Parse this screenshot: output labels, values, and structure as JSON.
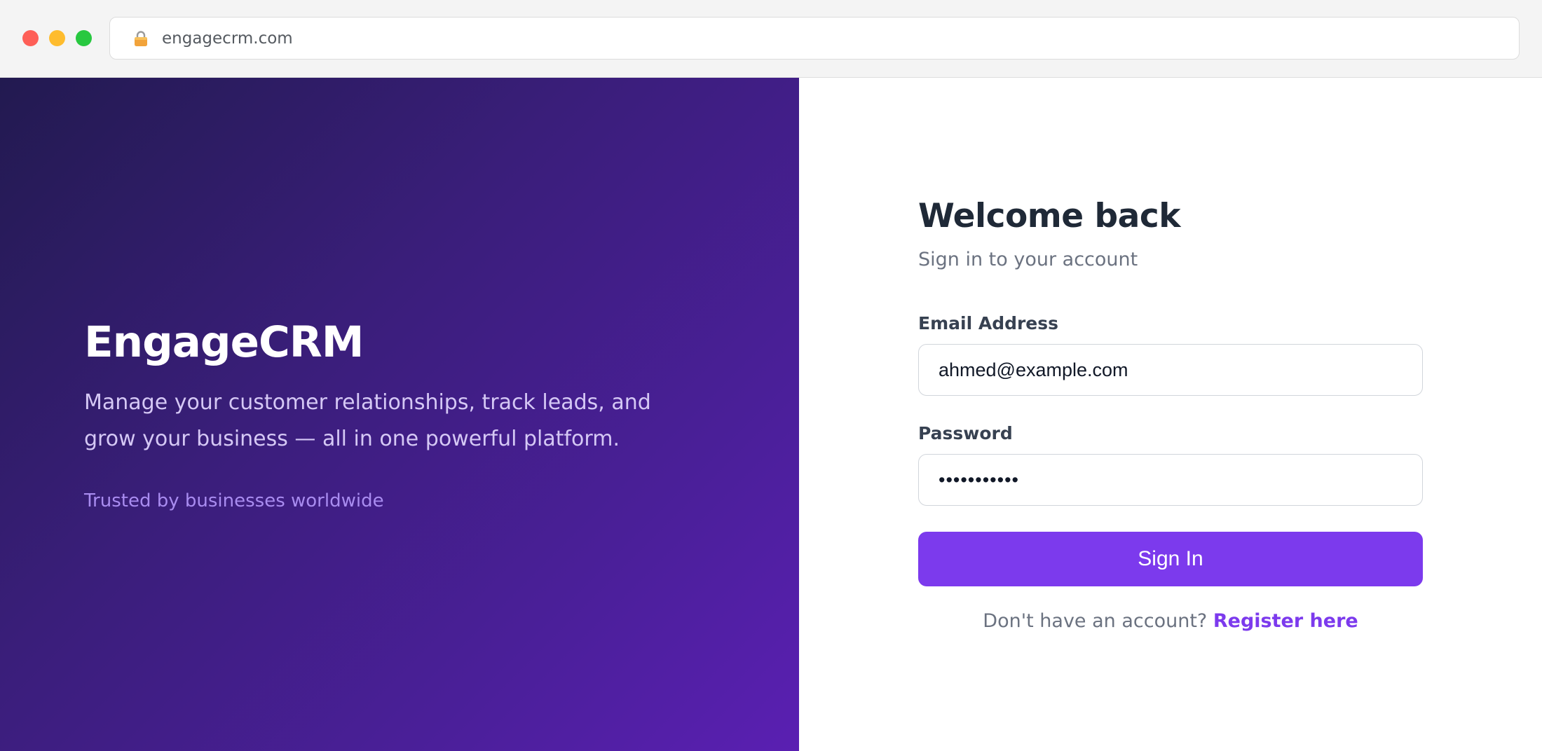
{
  "browser": {
    "url": "engagecrm.com",
    "lock_icon": "lock-icon",
    "window_controls": [
      "close",
      "minimize",
      "maximize"
    ]
  },
  "hero": {
    "brand": "EngageCRM",
    "tagline": "Manage your customer relationships, track leads, and grow your business — all in one powerful platform.",
    "trust_text": "Trusted by businesses worldwide"
  },
  "login": {
    "title": "Welcome back",
    "subtitle": "Sign in to your account",
    "email_label": "Email Address",
    "email_value": "ahmed@example.com",
    "password_label": "Password",
    "password_value": "ahmedpass12",
    "sign_in_label": "Sign In",
    "register_prompt": "Don't have an account?",
    "register_link": "Register here"
  },
  "colors": {
    "accent": "#7c3aed",
    "hero_gradient_start": "#221a50",
    "hero_gradient_end": "#5a1fb2",
    "heading": "#1f2937",
    "muted": "#6b7280"
  }
}
